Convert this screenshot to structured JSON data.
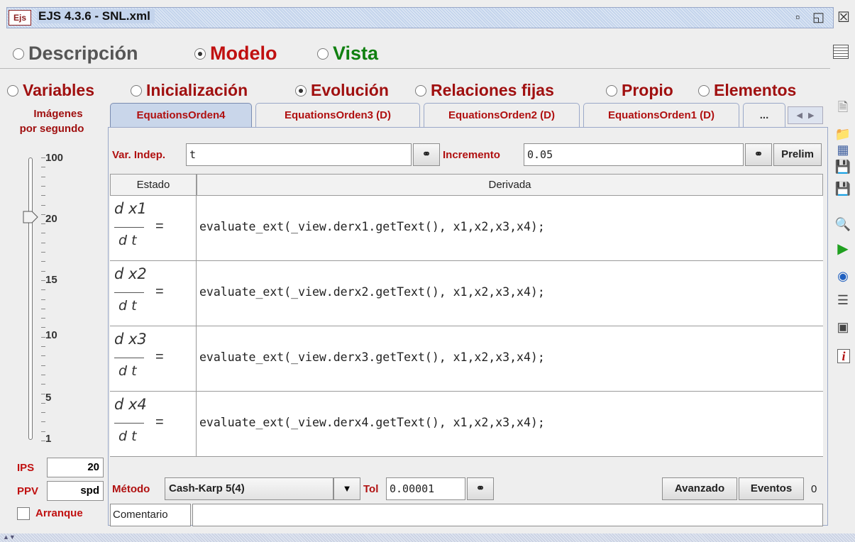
{
  "window": {
    "title": "EJS 4.3.6 - SNL.xml",
    "logo": "Ejs",
    "minimize_icon": "restore-icon",
    "maximize_icon": "maximize-icon",
    "close_icon": "close-icon"
  },
  "modes": [
    {
      "label": "Descripción",
      "selected": false,
      "color": "#555555"
    },
    {
      "label": "Modelo",
      "selected": true,
      "color": "#c01010"
    },
    {
      "label": "Vista",
      "selected": false,
      "color": "#108010"
    }
  ],
  "subtabs": [
    {
      "label": "Variables",
      "selected": false
    },
    {
      "label": "Inicialización",
      "selected": false
    },
    {
      "label": "Evolución",
      "selected": true
    },
    {
      "label": "Relaciones fijas",
      "selected": false
    },
    {
      "label": "Propio",
      "selected": false
    },
    {
      "label": "Elementos",
      "selected": false
    }
  ],
  "fps": {
    "label_line1": "Imágenes",
    "label_line2": "por segundo",
    "ticks": [
      "100",
      "20",
      "15",
      "10",
      "5",
      "1"
    ],
    "value": 20,
    "ips_label": "IPS",
    "ips_value": "20",
    "ppv_label": "PPV",
    "ppv_value": "spd",
    "autostart_label": "Arranque",
    "autostart_checked": false
  },
  "equation_tabs": [
    {
      "label": "EquationsOrden4",
      "active": true
    },
    {
      "label": "EquationsOrden3 (D)",
      "active": false
    },
    {
      "label": "EquationsOrden2 (D)",
      "active": false
    },
    {
      "label": "EquationsOrden1 (D)",
      "active": false
    },
    {
      "label": "...",
      "active": false
    }
  ],
  "editor": {
    "indep_label": "Var. Indep.",
    "indep_value": "t",
    "increment_label": "Incremento",
    "increment_value": "0.05",
    "prelim_label": "Prelim",
    "columns": [
      "Estado",
      "Derivada"
    ],
    "rows": [
      {
        "numerator": "d x1",
        "denominator": "d t",
        "equals": "=",
        "code": "evaluate_ext(_view.derx1.getText(), x1,x2,x3,x4);"
      },
      {
        "numerator": "d x2",
        "denominator": "d t",
        "equals": "=",
        "code": "evaluate_ext(_view.derx2.getText(), x1,x2,x3,x4);"
      },
      {
        "numerator": "d x3",
        "denominator": "d t",
        "equals": "=",
        "code": "evaluate_ext(_view.derx3.getText(), x1,x2,x3,x4);"
      },
      {
        "numerator": "d x4",
        "denominator": "d t",
        "equals": "=",
        "code": "evaluate_ext(_view.derx4.getText(), x1,x2,x3,x4);"
      }
    ],
    "method_label": "Método",
    "method_value": "Cash-Karp 5(4)",
    "tol_label": "Tol",
    "tol_value": "0.00001",
    "advanced_label": "Avanzado",
    "events_label": "Eventos",
    "events_count": "0",
    "comment_label": "Comentario",
    "comment_value": ""
  },
  "side_icons": [
    "new-file-icon",
    "open-folder-icon",
    "network-icon",
    "save-icon",
    "save-as-icon",
    "search-doc-icon",
    "run-icon",
    "web-icon",
    "stack-icon",
    "properties-icon",
    "info-icon"
  ],
  "top_right_icon": "table-icon"
}
